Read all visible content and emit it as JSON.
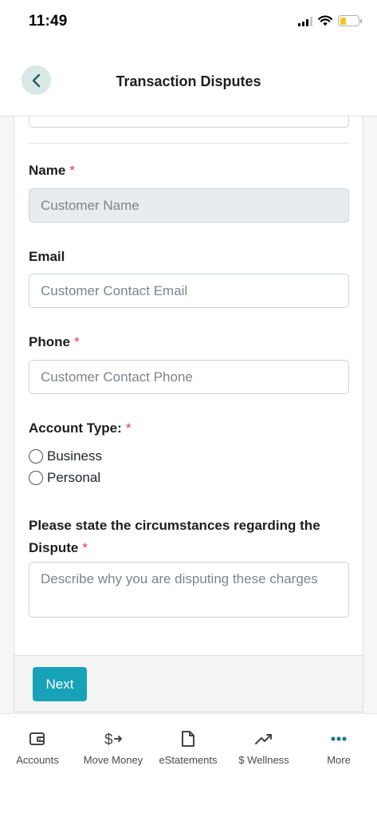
{
  "status_bar": {
    "time": "11:49"
  },
  "header": {
    "title": "Transaction Disputes"
  },
  "form": {
    "name": {
      "label": "Name",
      "required_mark": "*",
      "placeholder": "Customer Name"
    },
    "email": {
      "label": "Email",
      "placeholder": "Customer Contact Email"
    },
    "phone": {
      "label": "Phone",
      "required_mark": "*",
      "placeholder": "Customer Contact Phone"
    },
    "account_type": {
      "label": "Account Type:",
      "required_mark": "*",
      "options": [
        {
          "label": "Business",
          "selected": false
        },
        {
          "label": "Personal",
          "selected": false
        }
      ]
    },
    "circumstances": {
      "label_line1": "Please state the circumstances regarding the",
      "label_line2": "Dispute",
      "required_mark": "*",
      "placeholder": "Describe why you are disputing these charges"
    },
    "next_label": "Next"
  },
  "tabbar": {
    "items": [
      {
        "label": "Accounts",
        "icon": "wallet-icon"
      },
      {
        "label": "Move Money",
        "icon": "dollar-transfer-icon"
      },
      {
        "label": "eStatements",
        "icon": "document-icon"
      },
      {
        "label": "$ Wellness",
        "icon": "trend-up-icon"
      },
      {
        "label": "More",
        "icon": "more-dots-icon"
      }
    ]
  },
  "colors": {
    "accent": "#17a2b8",
    "required": "#e0394a",
    "back_button_bg": "#d9e8e6",
    "battery": "#f5c518"
  }
}
